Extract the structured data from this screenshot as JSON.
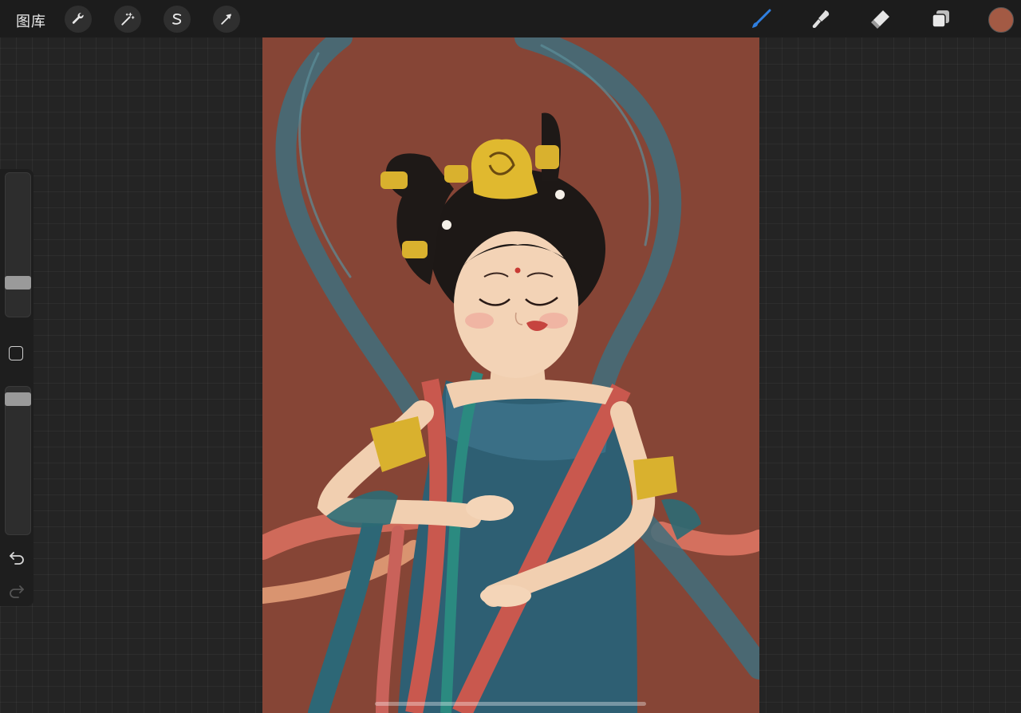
{
  "topbar": {
    "gallery_label": "图库",
    "left_tools": [
      {
        "name": "actions",
        "icon": "wrench-icon"
      },
      {
        "name": "adjustments",
        "icon": "magic-wand-icon"
      },
      {
        "name": "selection",
        "icon": "selection-s-icon"
      },
      {
        "name": "transform",
        "icon": "arrow-cursor-icon"
      }
    ],
    "right_tools": [
      {
        "name": "brush",
        "icon": "brush-icon",
        "active": true
      },
      {
        "name": "smudge",
        "icon": "smudge-icon"
      },
      {
        "name": "eraser",
        "icon": "eraser-icon"
      },
      {
        "name": "layers",
        "icon": "layers-icon"
      }
    ],
    "current_color": "#a35a44",
    "accent_color": "#2f7fe0"
  },
  "sidebar": {
    "brush_size_level": 0.2,
    "opacity_level": 0.97,
    "icons": [
      "modify-square-icon",
      "undo-icon",
      "redo-icon"
    ]
  },
  "canvas": {
    "background_color": "#864536",
    "subject": "feitian-dancer-illustration"
  }
}
